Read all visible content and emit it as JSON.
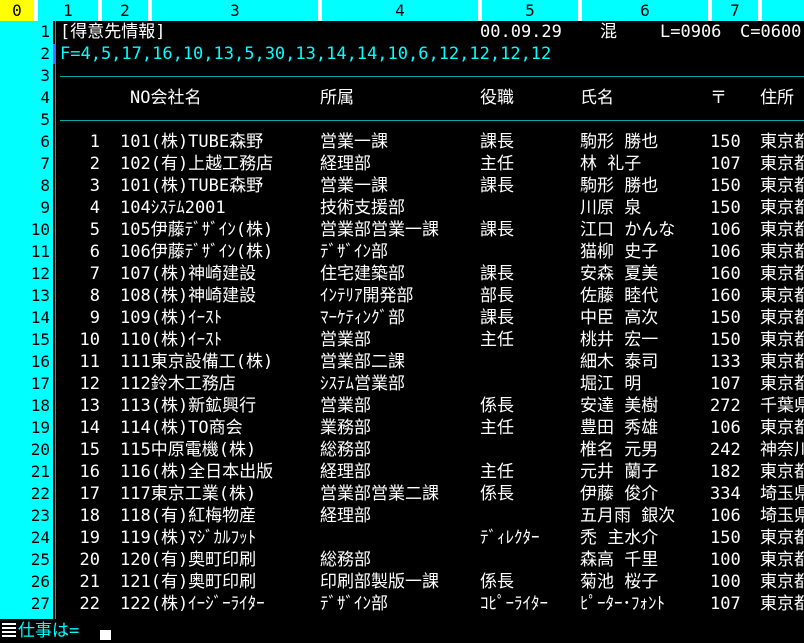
{
  "ruler": [
    "0",
    "1",
    "2",
    "3",
    "4",
    "5",
    "6",
    "7"
  ],
  "header": {
    "title": "[得意先情報]",
    "date": "00.09.29",
    "mode": "混",
    "line": "L=0906",
    "col": "C=0600"
  },
  "field_def": "F=4,5,17,16,10,13,5,30,13,14,14,10,6,12,12,12,12",
  "columns": {
    "no_company": "NO会社名",
    "dept": "所属",
    "title": "役職",
    "name": "氏名",
    "zip": "〒",
    "address": "住所"
  },
  "line_numbers": [
    "1",
    "2",
    "3",
    "4",
    "5",
    "6",
    "7",
    "8",
    "9",
    "10",
    "11",
    "12",
    "13",
    "14",
    "15",
    "16",
    "17",
    "18",
    "19",
    "20",
    "21",
    "22",
    "23",
    "24",
    "25",
    "26",
    "27"
  ],
  "rows": [
    {
      "no": "1",
      "company": "101(株)TUBE森野",
      "dept": "営業一課",
      "title": "課長",
      "name": "駒形 勝也",
      "zip": "150",
      "addr": "東京都"
    },
    {
      "no": "2",
      "company": "102(有)上越工務店",
      "dept": "経理部",
      "title": "主任",
      "name": "林 礼子",
      "zip": "107",
      "addr": "東京都"
    },
    {
      "no": "3",
      "company": "101(株)TUBE森野",
      "dept": "営業一課",
      "title": "課長",
      "name": "駒形 勝也",
      "zip": "150",
      "addr": "東京都"
    },
    {
      "no": "4",
      "company": "104ｼｽﾃﾑ2001",
      "dept": "技術支援部",
      "title": "",
      "name": "川原 泉",
      "zip": "150",
      "addr": "東京都"
    },
    {
      "no": "5",
      "company": "105伊藤ﾃﾞｻﾞｲﾝ(株)",
      "dept": "営業部営業一課",
      "title": "課長",
      "name": "江口 かんな",
      "zip": "106",
      "addr": "東京都"
    },
    {
      "no": "6",
      "company": "106伊藤ﾃﾞｻﾞｲﾝ(株)",
      "dept": "ﾃﾞｻﾞｲﾝ部",
      "title": "",
      "name": "猫柳 史子",
      "zip": "106",
      "addr": "東京都"
    },
    {
      "no": "7",
      "company": "107(株)神崎建設",
      "dept": "住宅建築部",
      "title": "課長",
      "name": "安森 夏美",
      "zip": "160",
      "addr": "東京都"
    },
    {
      "no": "8",
      "company": "108(株)神崎建設",
      "dept": "ｲﾝﾃﾘｱ開発部",
      "title": "部長",
      "name": "佐藤 睦代",
      "zip": "160",
      "addr": "東京都"
    },
    {
      "no": "9",
      "company": "109(株)ｲｰｽﾄ",
      "dept": "ﾏｰｹﾃｨﾝｸﾞ部",
      "title": "課長",
      "name": "中臣 高次",
      "zip": "150",
      "addr": "東京都"
    },
    {
      "no": "10",
      "company": "110(株)ｲｰｽﾄ",
      "dept": "営業部",
      "title": "主任",
      "name": "桃井 宏一",
      "zip": "150",
      "addr": "東京都"
    },
    {
      "no": "11",
      "company": "111東京設備工(株)",
      "dept": "営業部二課",
      "title": "",
      "name": "細木 泰司",
      "zip": "133",
      "addr": "東京都"
    },
    {
      "no": "12",
      "company": "112鈴木工務店",
      "dept": "ｼｽﾃﾑ営業部",
      "title": "",
      "name": "堀江 明",
      "zip": "107",
      "addr": "東京都"
    },
    {
      "no": "13",
      "company": "113(株)新鉱興行",
      "dept": "営業部",
      "title": "係長",
      "name": "安達 美樹",
      "zip": "272",
      "addr": "千葉県"
    },
    {
      "no": "14",
      "company": "114(株)TO商会",
      "dept": "業務部",
      "title": "主任",
      "name": "豊田 秀雄",
      "zip": "106",
      "addr": "東京都"
    },
    {
      "no": "15",
      "company": "115中原電機(株)",
      "dept": "総務部",
      "title": "",
      "name": "椎名 元男",
      "zip": "242",
      "addr": "神奈川"
    },
    {
      "no": "16",
      "company": "116(株)全日本出版",
      "dept": "経理部",
      "title": "主任",
      "name": "元井 蘭子",
      "zip": "182",
      "addr": "東京都"
    },
    {
      "no": "17",
      "company": "117東京工業(株)",
      "dept": "営業部営業二課",
      "title": "係長",
      "name": "伊藤 俊介",
      "zip": "334",
      "addr": "埼玉県"
    },
    {
      "no": "18",
      "company": "118(有)紅梅物産",
      "dept": "経理部",
      "title": "",
      "name": "五月雨 銀次",
      "zip": "106",
      "addr": "埼玉県"
    },
    {
      "no": "19",
      "company": "119(株)ﾏｼﾞｶﾙﾌｯﾄ",
      "dept": "",
      "title": "ﾃﾞｨﾚｸﾀｰ",
      "name": "禿 主水介",
      "zip": "150",
      "addr": "東京都"
    },
    {
      "no": "20",
      "company": "120(有)奥町印刷",
      "dept": "総務部",
      "title": "",
      "name": "森高 千里",
      "zip": "100",
      "addr": "東京都"
    },
    {
      "no": "21",
      "company": "121(有)奥町印刷",
      "dept": "印刷部製版一課",
      "title": "係長",
      "name": "菊池 桜子",
      "zip": "100",
      "addr": "東京都"
    },
    {
      "no": "22",
      "company": "122(株)ｲｰｼﾞｰﾗｲﾀｰ",
      "dept": "ﾃﾞｻﾞｲﾝ部",
      "title": "ｺﾋﾟｰﾗｲﾀｰ",
      "name": "ﾋﾟｰﾀｰ･ﾌｫﾝﾄ",
      "zip": "107",
      "addr": "東京都"
    }
  ],
  "command": {
    "prompt": "仕事は="
  },
  "colors": {
    "ruler_bg": "#00ffff",
    "ruler_current": "#ffff00",
    "gutter_bg": "#00ffff",
    "background": "#000000",
    "text": "#ffffff",
    "field_def": "#00ffff"
  }
}
